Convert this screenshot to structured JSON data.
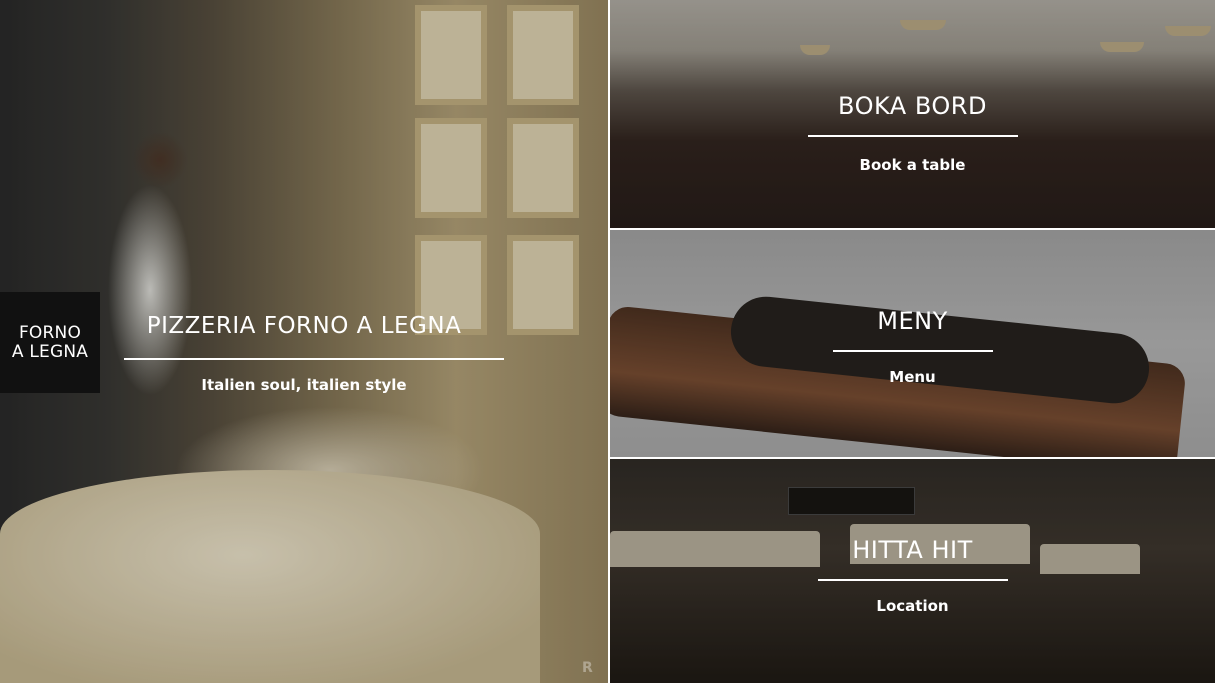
{
  "logo": {
    "line1": "FORNO",
    "line2": "A LEGNA"
  },
  "hero": {
    "title": "PIZZERIA FORNO A LEGNA",
    "subtitle": "Italien soul, italien style"
  },
  "panels": [
    {
      "id": "book",
      "title": "BOKA BORD",
      "subtitle": "Book a table"
    },
    {
      "id": "menu",
      "title": "MENY",
      "subtitle": "Menu"
    },
    {
      "id": "location",
      "title": "HITTA HIT",
      "subtitle": "Location"
    }
  ],
  "watermark": "R",
  "colors": {
    "overlay_text": "#ffffff",
    "logo_bg": "#111111",
    "divider": "#ffffff"
  }
}
